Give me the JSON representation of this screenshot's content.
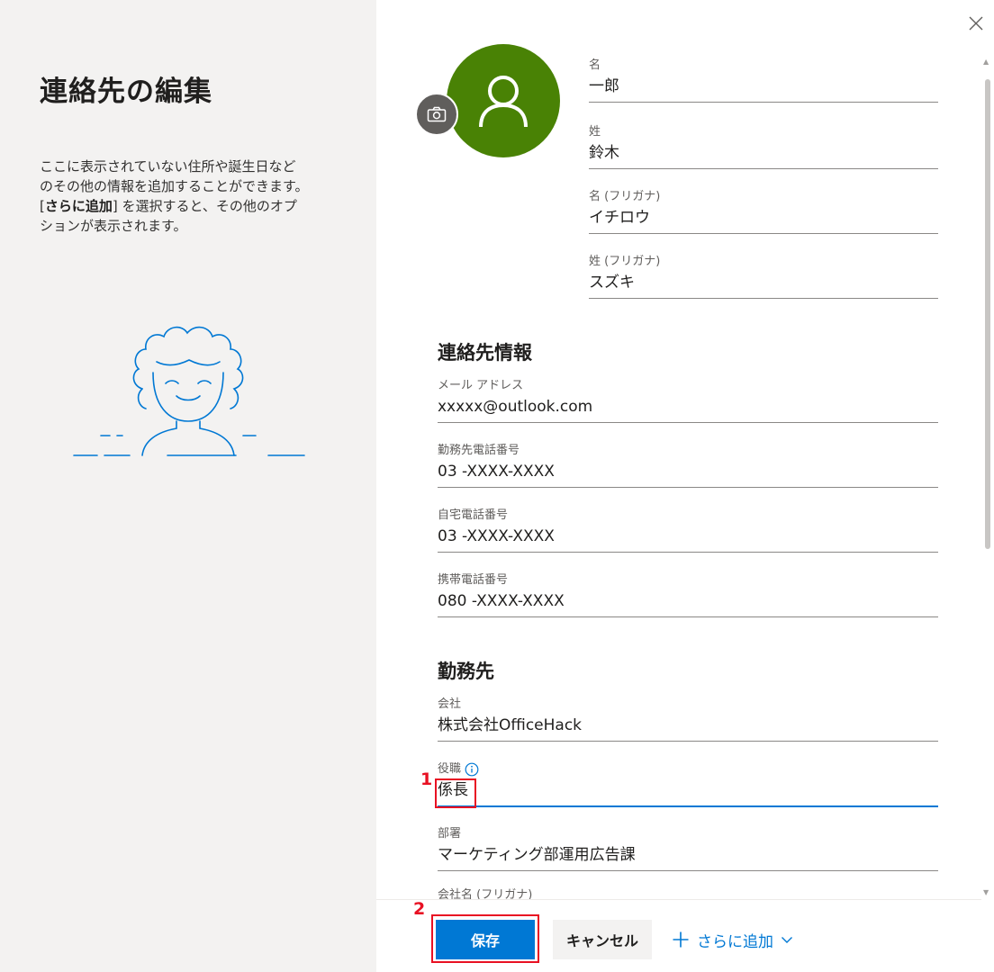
{
  "sidebar": {
    "title": "連絡先の編集",
    "description_line1": "ここに表示されていない住所や誕生日など",
    "description_line2": "のその他の情報を追加することができます。",
    "description_bracket_open": "[",
    "description_bold": "さらに追加",
    "description_after_bold": "] を選択すると、その他のオプ",
    "description_line4": "ションが表示されます。"
  },
  "name_fields": [
    {
      "label": "名",
      "value": "一郎"
    },
    {
      "label": "姓",
      "value": "鈴木"
    },
    {
      "label": "名 (フリガナ)",
      "value": "イチロウ"
    },
    {
      "label": "姓 (フリガナ)",
      "value": "スズキ"
    }
  ],
  "contact_section": {
    "title": "連絡先情報",
    "fields": [
      {
        "label": "メール アドレス",
        "value": "xxxxx@outlook.com"
      },
      {
        "label": "勤務先電話番号",
        "value": "03 -XXXX-XXXX"
      },
      {
        "label": "自宅電話番号",
        "value": "03 -XXXX-XXXX"
      },
      {
        "label": "携帯電話番号",
        "value": "080 -XXXX-XXXX"
      }
    ]
  },
  "work_section": {
    "title": "勤務先",
    "fields": [
      {
        "label": "会社",
        "value": "株式会社OfficeHack"
      },
      {
        "label": "役職",
        "value": "係長"
      },
      {
        "label": "部署",
        "value": "マーケティング部運用広告課"
      },
      {
        "label": "会社名 (フリガナ)",
        "value": ""
      }
    ]
  },
  "annotations": {
    "step1": "1",
    "step2": "2"
  },
  "footer": {
    "save_label": "保存",
    "cancel_label": "キャンセル",
    "add_more_label": "さらに追加"
  },
  "icons": {
    "close": "close-icon",
    "camera": "camera-icon",
    "avatar": "person-icon",
    "info": "info-icon",
    "plus": "plus-icon",
    "chevron": "chevron-down-icon"
  },
  "colors": {
    "accent": "#0078d4",
    "avatar_bg": "#498205",
    "highlight": "#e81123",
    "sidebar_bg": "#f3f2f1"
  }
}
